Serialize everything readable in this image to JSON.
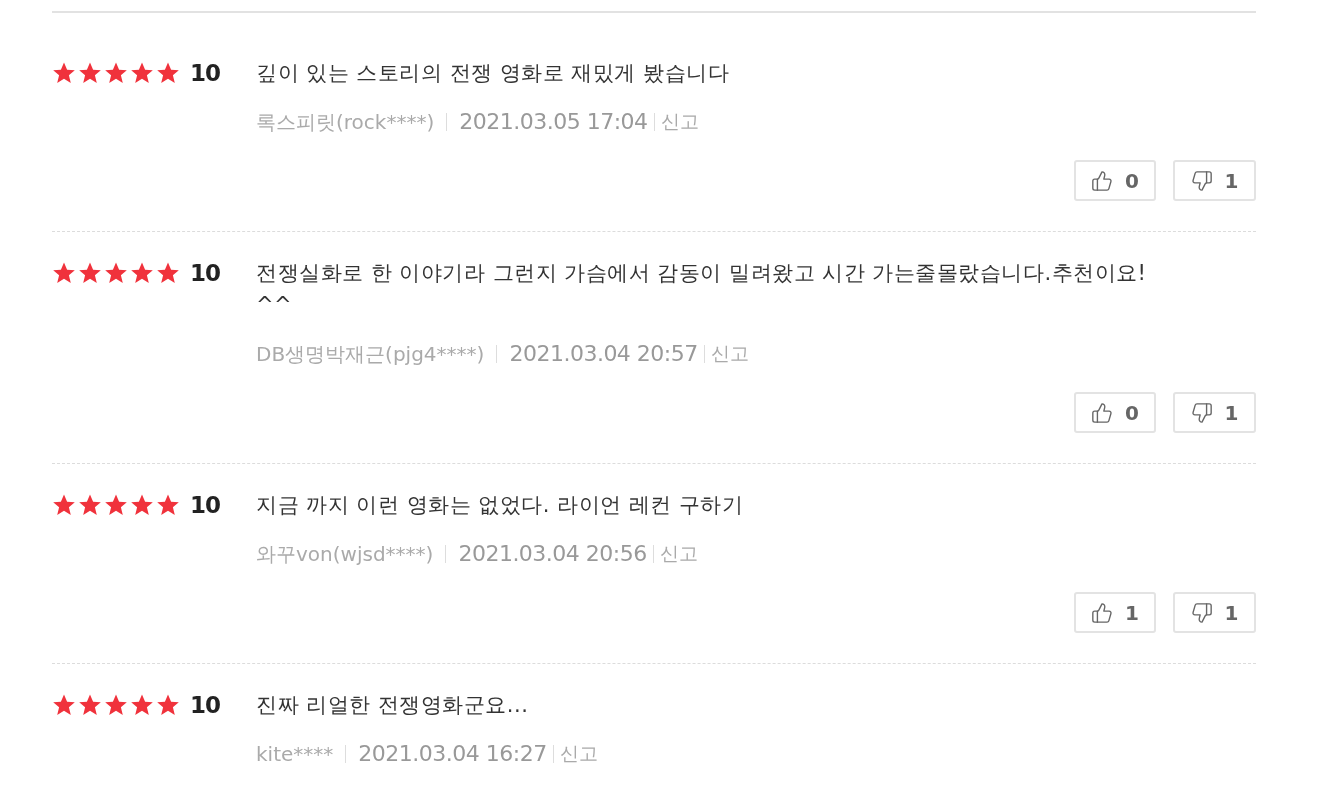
{
  "reviews": [
    {
      "stars": 5,
      "score": "10",
      "text": "깊이 있는 스토리의 전쟁 영화로 재밌게 봤습니다",
      "author": "록스피릿(rock****)",
      "date": "2021.03.05 17:04",
      "report": "신고",
      "likes": "0",
      "dislikes": "1"
    },
    {
      "stars": 5,
      "score": "10",
      "text": "전쟁실화로 한 이야기라 그런지 가슴에서 감동이 밀려왔고 시간 가는줄몰랐습니다.추천이요! ^^",
      "author": "DB생명박재근(pjg4****)",
      "date": "2021.03.04 20:57",
      "report": "신고",
      "likes": "0",
      "dislikes": "1"
    },
    {
      "stars": 5,
      "score": "10",
      "text": "지금 까지 이런 영화는 없었다. 라이언 레컨 구하기",
      "author": "와꾸von(wjsd****)",
      "date": "2021.03.04 20:56",
      "report": "신고",
      "likes": "1",
      "dislikes": "1"
    },
    {
      "stars": 5,
      "score": "10",
      "text": "진짜 리얼한 전쟁영화군요...",
      "author": "kite****",
      "date": "2021.03.04 16:27",
      "report": "신고"
    }
  ]
}
